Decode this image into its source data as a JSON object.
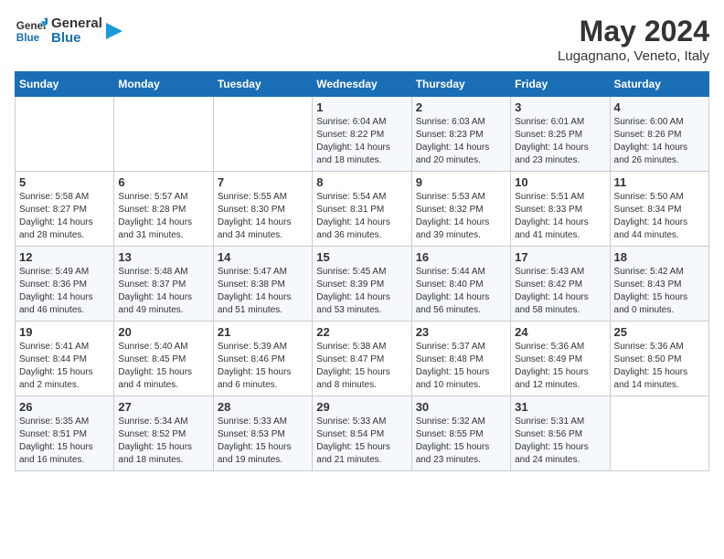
{
  "logo": {
    "line1": "General",
    "line2": "Blue"
  },
  "title": "May 2024",
  "location": "Lugagnano, Veneto, Italy",
  "weekdays": [
    "Sunday",
    "Monday",
    "Tuesday",
    "Wednesday",
    "Thursday",
    "Friday",
    "Saturday"
  ],
  "weeks": [
    [
      {
        "day": "",
        "info": ""
      },
      {
        "day": "",
        "info": ""
      },
      {
        "day": "",
        "info": ""
      },
      {
        "day": "1",
        "info": "Sunrise: 6:04 AM\nSunset: 8:22 PM\nDaylight: 14 hours\nand 18 minutes."
      },
      {
        "day": "2",
        "info": "Sunrise: 6:03 AM\nSunset: 8:23 PM\nDaylight: 14 hours\nand 20 minutes."
      },
      {
        "day": "3",
        "info": "Sunrise: 6:01 AM\nSunset: 8:25 PM\nDaylight: 14 hours\nand 23 minutes."
      },
      {
        "day": "4",
        "info": "Sunrise: 6:00 AM\nSunset: 8:26 PM\nDaylight: 14 hours\nand 26 minutes."
      }
    ],
    [
      {
        "day": "5",
        "info": "Sunrise: 5:58 AM\nSunset: 8:27 PM\nDaylight: 14 hours\nand 28 minutes."
      },
      {
        "day": "6",
        "info": "Sunrise: 5:57 AM\nSunset: 8:28 PM\nDaylight: 14 hours\nand 31 minutes."
      },
      {
        "day": "7",
        "info": "Sunrise: 5:55 AM\nSunset: 8:30 PM\nDaylight: 14 hours\nand 34 minutes."
      },
      {
        "day": "8",
        "info": "Sunrise: 5:54 AM\nSunset: 8:31 PM\nDaylight: 14 hours\nand 36 minutes."
      },
      {
        "day": "9",
        "info": "Sunrise: 5:53 AM\nSunset: 8:32 PM\nDaylight: 14 hours\nand 39 minutes."
      },
      {
        "day": "10",
        "info": "Sunrise: 5:51 AM\nSunset: 8:33 PM\nDaylight: 14 hours\nand 41 minutes."
      },
      {
        "day": "11",
        "info": "Sunrise: 5:50 AM\nSunset: 8:34 PM\nDaylight: 14 hours\nand 44 minutes."
      }
    ],
    [
      {
        "day": "12",
        "info": "Sunrise: 5:49 AM\nSunset: 8:36 PM\nDaylight: 14 hours\nand 46 minutes."
      },
      {
        "day": "13",
        "info": "Sunrise: 5:48 AM\nSunset: 8:37 PM\nDaylight: 14 hours\nand 49 minutes."
      },
      {
        "day": "14",
        "info": "Sunrise: 5:47 AM\nSunset: 8:38 PM\nDaylight: 14 hours\nand 51 minutes."
      },
      {
        "day": "15",
        "info": "Sunrise: 5:45 AM\nSunset: 8:39 PM\nDaylight: 14 hours\nand 53 minutes."
      },
      {
        "day": "16",
        "info": "Sunrise: 5:44 AM\nSunset: 8:40 PM\nDaylight: 14 hours\nand 56 minutes."
      },
      {
        "day": "17",
        "info": "Sunrise: 5:43 AM\nSunset: 8:42 PM\nDaylight: 14 hours\nand 58 minutes."
      },
      {
        "day": "18",
        "info": "Sunrise: 5:42 AM\nSunset: 8:43 PM\nDaylight: 15 hours\nand 0 minutes."
      }
    ],
    [
      {
        "day": "19",
        "info": "Sunrise: 5:41 AM\nSunset: 8:44 PM\nDaylight: 15 hours\nand 2 minutes."
      },
      {
        "day": "20",
        "info": "Sunrise: 5:40 AM\nSunset: 8:45 PM\nDaylight: 15 hours\nand 4 minutes."
      },
      {
        "day": "21",
        "info": "Sunrise: 5:39 AM\nSunset: 8:46 PM\nDaylight: 15 hours\nand 6 minutes."
      },
      {
        "day": "22",
        "info": "Sunrise: 5:38 AM\nSunset: 8:47 PM\nDaylight: 15 hours\nand 8 minutes."
      },
      {
        "day": "23",
        "info": "Sunrise: 5:37 AM\nSunset: 8:48 PM\nDaylight: 15 hours\nand 10 minutes."
      },
      {
        "day": "24",
        "info": "Sunrise: 5:36 AM\nSunset: 8:49 PM\nDaylight: 15 hours\nand 12 minutes."
      },
      {
        "day": "25",
        "info": "Sunrise: 5:36 AM\nSunset: 8:50 PM\nDaylight: 15 hours\nand 14 minutes."
      }
    ],
    [
      {
        "day": "26",
        "info": "Sunrise: 5:35 AM\nSunset: 8:51 PM\nDaylight: 15 hours\nand 16 minutes."
      },
      {
        "day": "27",
        "info": "Sunrise: 5:34 AM\nSunset: 8:52 PM\nDaylight: 15 hours\nand 18 minutes."
      },
      {
        "day": "28",
        "info": "Sunrise: 5:33 AM\nSunset: 8:53 PM\nDaylight: 15 hours\nand 19 minutes."
      },
      {
        "day": "29",
        "info": "Sunrise: 5:33 AM\nSunset: 8:54 PM\nDaylight: 15 hours\nand 21 minutes."
      },
      {
        "day": "30",
        "info": "Sunrise: 5:32 AM\nSunset: 8:55 PM\nDaylight: 15 hours\nand 23 minutes."
      },
      {
        "day": "31",
        "info": "Sunrise: 5:31 AM\nSunset: 8:56 PM\nDaylight: 15 hours\nand 24 minutes."
      },
      {
        "day": "",
        "info": ""
      }
    ]
  ]
}
